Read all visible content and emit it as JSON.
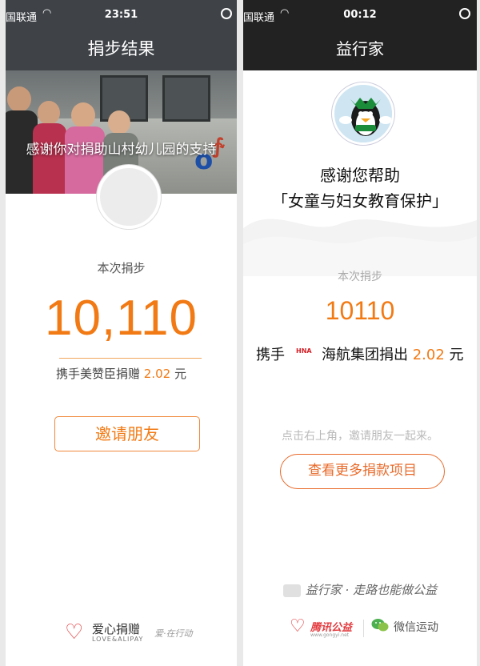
{
  "left": {
    "status": {
      "carrier": "国联通",
      "time": "23:51"
    },
    "nav_title": "捐步结果",
    "banner_caption": "感谢你对捐助山村幼儿园的支持",
    "steps_label": "本次捐步",
    "steps_value": "10,110",
    "donor_text": "携手美赞臣捐赠 ",
    "donation_amount": "2.02",
    "currency": " 元",
    "invite_button": "邀请朋友",
    "footer": {
      "brand": "爱心捐赠",
      "brand_sub": "LOVE&ALIPAY",
      "brand2": "爱·在行动"
    }
  },
  "right": {
    "status": {
      "carrier": "国联通",
      "time": "00:12"
    },
    "nav_title": "益行家",
    "thanks_line": "感谢您帮助",
    "project_name": "「女童与妇女教育保护」",
    "steps_label": "本次捐步",
    "steps_value": "10110",
    "donor_prefix": "携手",
    "sponsor_logo_text": "HNA",
    "donor_text": "海航集团捐出 ",
    "donation_amount": "2.02",
    "currency": " 元",
    "hint": "点击右上角，邀请朋友一起来。",
    "more_button": "查看更多捐款项目",
    "slogan": "益行家 · 走路也能做公益",
    "footer": {
      "brand": "腾讯公益",
      "brand_sub": "www.gongyi.net",
      "brand2": "微信运动"
    }
  },
  "colors": {
    "accent": "#f27a14",
    "nav_left": "#3f4348",
    "nav_right": "#222222",
    "heart": "#e23a3e"
  }
}
